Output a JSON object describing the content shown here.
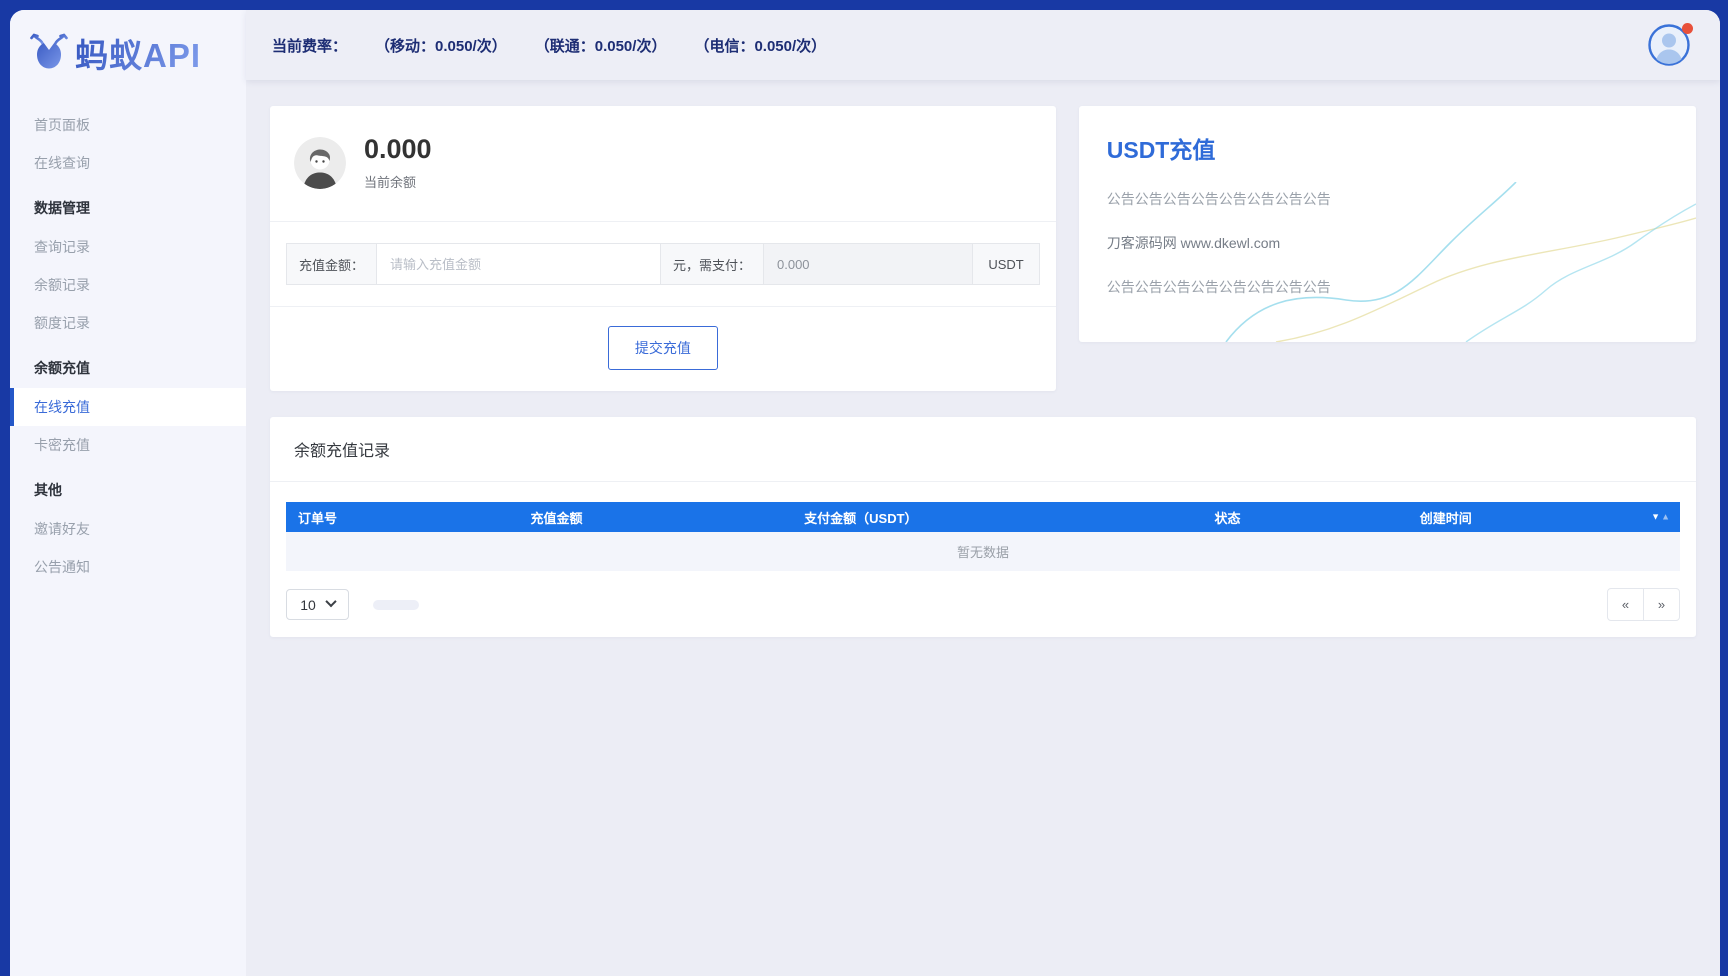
{
  "logo": {
    "text": "蚂蚁API"
  },
  "topbar": {
    "rate_label": "当前费率：",
    "rates": [
      "（移动：0.050/次）",
      "（联通：0.050/次）",
      "（电信：0.050/次）"
    ]
  },
  "sidebar": {
    "items": [
      {
        "label": "首页面板",
        "type": "item"
      },
      {
        "label": "在线查询",
        "type": "item"
      },
      {
        "label": "数据管理",
        "type": "section"
      },
      {
        "label": "查询记录",
        "type": "item"
      },
      {
        "label": "余额记录",
        "type": "item"
      },
      {
        "label": "额度记录",
        "type": "item"
      },
      {
        "label": "余额充值",
        "type": "section"
      },
      {
        "label": "在线充值",
        "type": "item",
        "active": true
      },
      {
        "label": "卡密充值",
        "type": "item"
      },
      {
        "label": "其他",
        "type": "section"
      },
      {
        "label": "邀请好友",
        "type": "item"
      },
      {
        "label": "公告通知",
        "type": "item"
      }
    ]
  },
  "balance_card": {
    "amount": "0.000",
    "label": "当前余额",
    "form": {
      "amount_label": "充值金额：",
      "amount_placeholder": "请输入充值金额",
      "pay_label": "元，需支付：",
      "pay_value": "0.000",
      "currency": "USDT"
    },
    "submit_label": "提交充值"
  },
  "usdt_panel": {
    "title": "USDT充值",
    "lines": [
      "公告公告公告公告公告公告公告公告",
      "刀客源码网 www.dkewl.com",
      "公告公告公告公告公告公告公告公告"
    ]
  },
  "records": {
    "title": "余额充值记录",
    "columns": [
      "订单号",
      "充值金额",
      "支付金额（USDT）",
      "状态",
      "创建时间"
    ],
    "rows": [],
    "empty_text": "暂无数据",
    "sort": {
      "desc": "▼",
      "asc": "▲"
    },
    "pagination": {
      "page_size": "10",
      "prev": "«",
      "next": "»"
    }
  },
  "colors": {
    "frame_blue": "#1839a4",
    "accent_blue": "#3a6bd8",
    "table_header_blue": "#1a73e8",
    "navy_text": "#1d2d74",
    "notification_red": "#e8503a",
    "sidebar_bg": "#f4f5fc",
    "main_bg": "#ecedf5"
  }
}
